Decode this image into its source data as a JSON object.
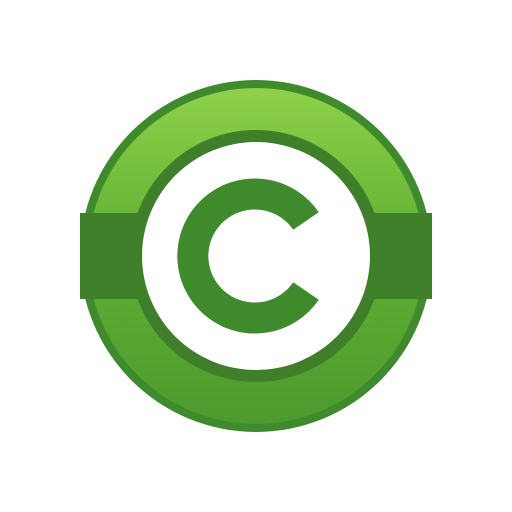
{
  "logo": {
    "icon": "copyright-icon",
    "glyph": "C",
    "colors": {
      "outer_ring": "#3f8a2c",
      "ring_highlight": "#8fd14a",
      "ring_mid": "#62b134",
      "band": "#3f7f2a",
      "inner_disc": "#ffffff",
      "glyph": "#3f8a2c",
      "background": "#ffffff"
    }
  }
}
